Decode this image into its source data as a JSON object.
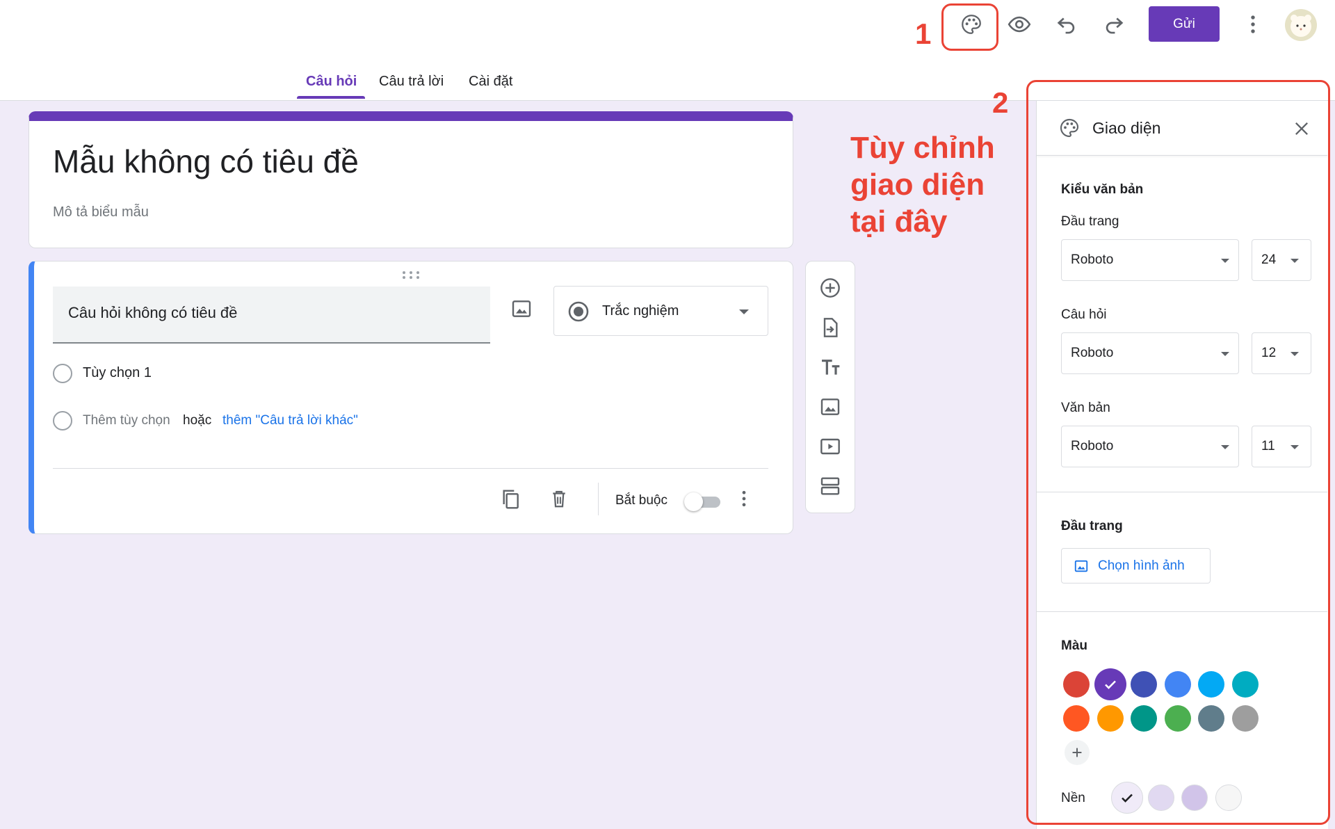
{
  "toolbar": {
    "send_label": "Gửi",
    "icons": [
      "palette-icon",
      "eye-icon",
      "undo-icon",
      "redo-icon",
      "more-vert-icon"
    ]
  },
  "tabs": [
    {
      "label": "Câu hỏi",
      "active": true
    },
    {
      "label": "Câu trả lời"
    },
    {
      "label": "Cài đặt"
    }
  ],
  "annotations": {
    "num1": "1",
    "num2": "2",
    "line1": "Tùy chỉnh",
    "line2": "giao diện",
    "line3": "tại đây",
    "color": "#ea4335"
  },
  "form": {
    "title": "Mẫu không có tiêu đề",
    "description": "Mô tả biểu mẫu",
    "accent_color": "#673ab7",
    "bg_color": "#f0ebf8"
  },
  "question": {
    "title": "Câu hỏi không có tiêu đề",
    "type": "Trắc nghiệm",
    "option1": "Tùy chọn 1",
    "add_option": "Thêm tùy chọn",
    "or": "hoặc",
    "add_other": "thêm \"Câu trả lời khác\"",
    "required_label": "Bắt buộc",
    "required": false
  },
  "theme_panel": {
    "title": "Giao diện",
    "text_style_heading": "Kiểu văn bản",
    "header_label": "Đầu trang",
    "header_font": "Roboto",
    "header_size": "24",
    "question_label": "Câu hỏi",
    "question_font": "Roboto",
    "question_size": "12",
    "text_label": "Văn bản",
    "text_font": "Roboto",
    "text_size": "11",
    "header_section": "Đầu trang",
    "choose_image": "Chọn hình ảnh",
    "color_heading": "Màu",
    "colors": [
      "#db4437",
      "#673ab7",
      "#3f51b5",
      "#4285f4",
      "#03a9f4",
      "#00acc1",
      "#ff5722",
      "#ff9800",
      "#009688",
      "#4caf50",
      "#607d8b",
      "#9e9e9e"
    ],
    "selected_color": "#673ab7",
    "background_label": "Nền",
    "backgrounds": [
      "#f0ebf8",
      "#e1d9f1",
      "#d1c4e9",
      "#f6f6f6"
    ]
  }
}
